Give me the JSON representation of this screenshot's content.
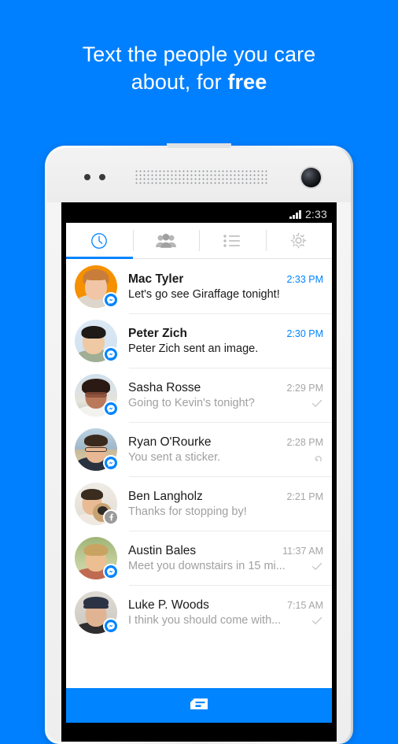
{
  "headline": {
    "line1": "Text the people you care",
    "line2_prefix": "about, for ",
    "line2_bold": "free"
  },
  "colors": {
    "background_blue": "#0080ff",
    "accent_blue": "#0084ff",
    "unread_text": "#1a1a1a",
    "read_text": "#a0a0a0",
    "badge_gray": "#9a9a9a"
  },
  "phone": {
    "status_bar": {
      "time": "2:33",
      "signal_icon": "signal-bars-icon"
    },
    "tabs": [
      {
        "id": "recent",
        "icon": "clock-icon",
        "label": "Recent",
        "active": true
      },
      {
        "id": "groups",
        "icon": "people-icon",
        "label": "Groups",
        "active": false
      },
      {
        "id": "contacts",
        "icon": "list-icon",
        "label": "Contacts",
        "active": false
      },
      {
        "id": "settings",
        "icon": "gear-icon",
        "label": "Settings",
        "active": false
      }
    ],
    "threads": [
      {
        "name": "Mac Tyler",
        "preview": "Let's go see Giraffage tonight!",
        "time": "2:33 PM",
        "unread": true,
        "badge": "messenger",
        "status_icon": "",
        "avatar": {
          "bg": "#f59000",
          "skin": "#f0c6a6",
          "hair": "#c87e3a",
          "shirt": "#ddd6cd"
        }
      },
      {
        "name": "Peter Zich",
        "preview": "Peter Zich sent an image.",
        "time": "2:30 PM",
        "unread": true,
        "badge": "messenger",
        "status_icon": "",
        "avatar": {
          "bg": "#dce9f4",
          "skin": "#eec9a4",
          "hair": "#1d1a17",
          "shirt": "#9fae94"
        }
      },
      {
        "name": "Sasha Rosse",
        "preview": "Going to Kevin's tonight?",
        "time": "2:29 PM",
        "unread": false,
        "badge": "messenger",
        "status_icon": "check-icon",
        "avatar": {
          "bg": "#cfe0ec",
          "skin": "#b9795a",
          "hair": "#2b1a14",
          "shirt": "#f2f2ee"
        }
      },
      {
        "name": "Ryan O'Rourke",
        "preview": "You sent a sticker.",
        "time": "2:28 PM",
        "unread": false,
        "badge": "messenger",
        "status_icon": "reply-icon",
        "avatar": {
          "bg": "#bcd3e2",
          "skin": "#e8b894",
          "hair": "#3a2a1e",
          "shirt": "#2a3240"
        }
      },
      {
        "name": "Ben Langholz",
        "preview": "Thanks for stopping by!",
        "time": "2:21 PM",
        "unread": false,
        "badge": "facebook",
        "status_icon": "",
        "avatar": {
          "bg": "#e7e2dc",
          "skin": "#e9bb95",
          "hair": "#3b2c20",
          "shirt": "#efe9e2"
        }
      },
      {
        "name": "Austin Bales",
        "preview": "Meet you downstairs in 15 mi...",
        "time": "11:37 AM",
        "unread": false,
        "badge": "messenger",
        "status_icon": "check-icon",
        "avatar": {
          "bg": "#b9c79a",
          "skin": "#ecbf92",
          "hair": "#c9a362",
          "shirt": "#c06a52"
        }
      },
      {
        "name": "Luke P. Woods",
        "preview": "I think you should come with...",
        "time": "7:15 AM",
        "unread": false,
        "badge": "messenger",
        "status_icon": "check-icon",
        "avatar": {
          "bg": "#d8d5ce",
          "skin": "#e0b492",
          "hair": "#2c3344",
          "shirt": "#2e2e30"
        }
      }
    ],
    "compose": {
      "icon": "new-message-icon",
      "label": "New Message"
    }
  }
}
